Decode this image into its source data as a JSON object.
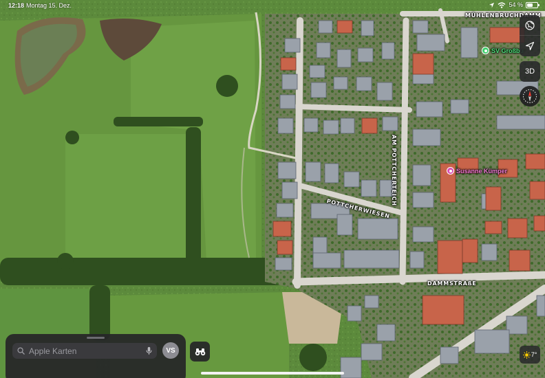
{
  "status_bar": {
    "time": "12:18",
    "date": "Montag 15. Dez.",
    "battery_text": "54 %",
    "battery_level": 0.54
  },
  "map": {
    "road_labels": [
      "MÜHLENBRUCHDAMM",
      "AM POTTCHERTEICH",
      "POTTCHERWIESEN",
      "DAMMSTRAßE"
    ],
    "pois": [
      {
        "label": "SV Großbu",
        "color": "#3fce6b",
        "icon": "sports-poi-icon"
      },
      {
        "label": "Susanne Kümper",
        "color": "#d94fb4",
        "icon": "place-poi-icon"
      }
    ]
  },
  "controls": {
    "three_d_label": "3D",
    "icons": [
      "globe-icon",
      "location-arrow-icon",
      "compass-icon",
      "binoculars-icon"
    ]
  },
  "weather": {
    "temperature": "7°",
    "icon": "sun-icon"
  },
  "search": {
    "placeholder": "Apple Karten",
    "avatar_initials": "VS"
  },
  "colors": {
    "meadow": "#5c8a3c",
    "road": "#d9d6cf",
    "panel": "#28282a",
    "poi_green": "#3fce6b",
    "poi_pink": "#d94fb4"
  }
}
